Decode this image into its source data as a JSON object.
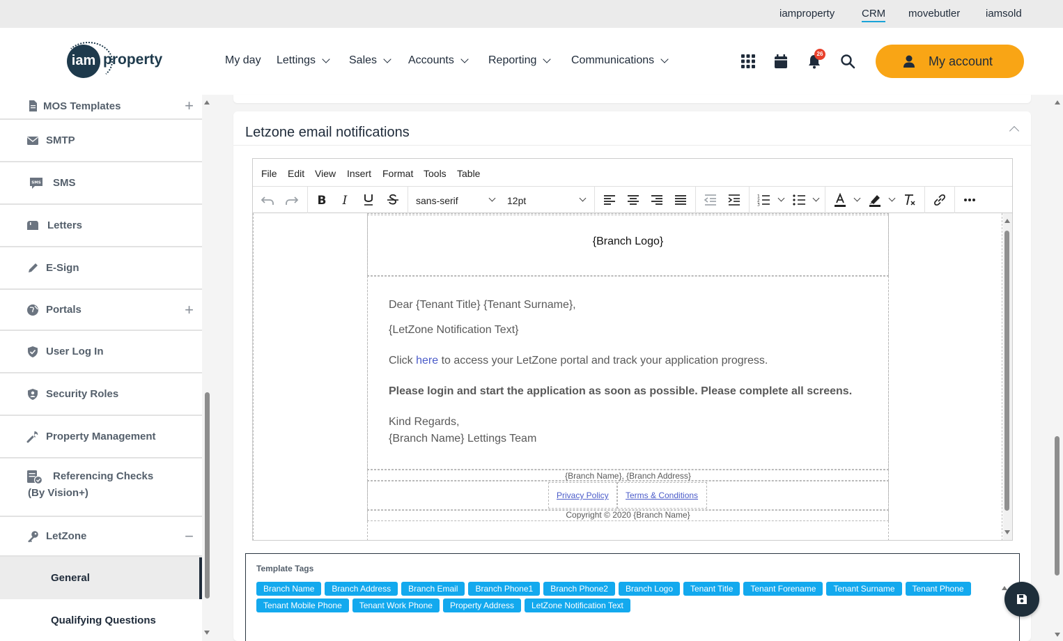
{
  "topbar": {
    "links": [
      "iamproperty",
      "CRM",
      "movebutler",
      "iamsold"
    ],
    "active": "CRM"
  },
  "header": {
    "logo": {
      "mark": "iam",
      "word": "property"
    },
    "nav": [
      {
        "label": "My day",
        "dropdown": false
      },
      {
        "label": "Lettings",
        "dropdown": true
      },
      {
        "label": "Sales",
        "dropdown": true
      },
      {
        "label": "Accounts",
        "dropdown": true
      },
      {
        "label": "Reporting",
        "dropdown": true
      },
      {
        "label": "Communications",
        "dropdown": true
      }
    ],
    "icons": [
      "apps-grid-icon",
      "calendar-icon",
      "bell-icon",
      "search-icon"
    ],
    "notification_count": "26",
    "my_account_label": "My account",
    "accent_color": "#f9a515"
  },
  "sidebar": {
    "items": [
      {
        "label": "MOS Templates",
        "icon": "document-icon",
        "toggle": "+"
      },
      {
        "label": "SMTP",
        "icon": "envelope-icon",
        "toggle": ""
      },
      {
        "label": "SMS",
        "icon": "sms-icon",
        "icon_text": "SMS",
        "toggle": ""
      },
      {
        "label": "Letters",
        "icon": "mailbox-icon",
        "toggle": ""
      },
      {
        "label": "E-Sign",
        "icon": "pen-icon",
        "toggle": ""
      },
      {
        "label": "Portals",
        "icon": "globe-icon",
        "toggle": "+"
      },
      {
        "label": "User Log In",
        "icon": "shield-check-icon",
        "toggle": ""
      },
      {
        "label": "Security Roles",
        "icon": "shield-user-icon",
        "toggle": ""
      },
      {
        "label": "Property Management",
        "icon": "wrench-icon",
        "toggle": ""
      },
      {
        "label": "Referencing Checks",
        "label2": "(By Vision+)",
        "icon": "checklist-icon",
        "toggle": ""
      },
      {
        "label": "LetZone",
        "icon": "key-icon",
        "toggle": "−"
      }
    ],
    "sub_items": [
      {
        "label": "General",
        "active": true
      },
      {
        "label": "Qualifying Questions",
        "active": false
      }
    ]
  },
  "panel": {
    "title": "Letzone email notifications"
  },
  "editor": {
    "menu": [
      "File",
      "Edit",
      "View",
      "Insert",
      "Format",
      "Tools",
      "Table"
    ],
    "font_family": "sans-serif",
    "font_size": "12pt",
    "content": {
      "logo_placeholder": "{Branch Logo}",
      "greeting": "Dear {Tenant Title} {Tenant Surname},",
      "notification": "{LetZone Notification Text}",
      "click_prefix": "Click ",
      "click_link": "here",
      "click_suffix": " to access your LetZone portal and track your application progress.",
      "bold_line": "Please login and start the application as soon as possible. Please complete all screens.",
      "regards": "Kind Regards,",
      "signoff": "{Branch Name} Lettings Team",
      "footer_address": "{Branch Name}, {Branch Address}",
      "privacy_link": "Privacy Policy",
      "terms_link": "Terms & Conditions",
      "copyright": "Copyright © 2020 {Branch Name}"
    }
  },
  "template_tags": {
    "title": "Template Tags",
    "tags": [
      "Branch Name",
      "Branch Address",
      "Branch Email",
      "Branch Phone1",
      "Branch Phone2",
      "Branch Logo",
      "Tenant Title",
      "Tenant Forename",
      "Tenant Surname",
      "Tenant Phone",
      "Tenant Mobile Phone",
      "Tenant Work Phone",
      "Property Address",
      "LetZone Notification Text"
    ],
    "tag_color": "#13a9ee"
  },
  "save_icon": "floppy-disk-icon"
}
